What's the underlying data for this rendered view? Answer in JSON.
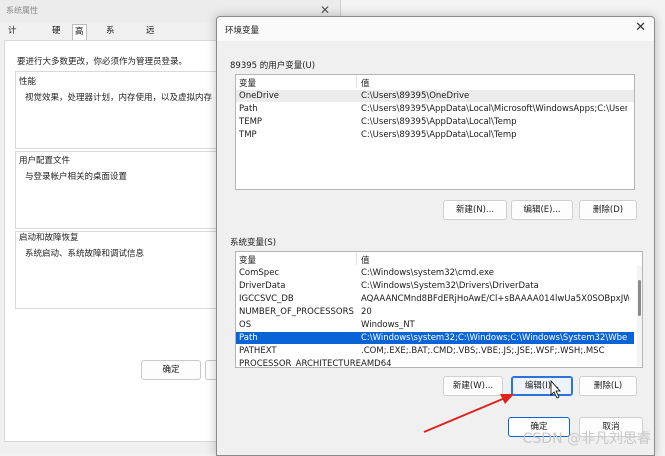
{
  "system_properties": {
    "title": "系统属性",
    "tabs": [
      "计算机名",
      "硬件",
      "高级",
      "系统保护",
      "远程"
    ],
    "admin_note": "要进行大多数更改，你必须作为管理员登录。",
    "performance": {
      "heading": "性能",
      "desc": "视觉效果，处理器计划，内存使用，以及虚拟内存"
    },
    "user_profiles": {
      "heading": "用户配置文件",
      "desc": "与登录帐户相关的桌面设置"
    },
    "startup_recovery": {
      "heading": "启动和故障恢复",
      "desc": "系统启动、系统故障和调试信息"
    },
    "ok_label": "确定"
  },
  "env_dialog": {
    "title": "环境变量",
    "user_section_label": "89395 的用户变量(U)",
    "system_section_label": "系统变量(S)",
    "columns": {
      "variable": "变量",
      "value": "值"
    },
    "user_vars": [
      {
        "name": "OneDrive",
        "value": "C:\\Users\\89395\\OneDrive"
      },
      {
        "name": "Path",
        "value": "C:\\Users\\89395\\AppData\\Local\\Microsoft\\WindowsApps;C:\\Users\\..."
      },
      {
        "name": "TEMP",
        "value": "C:\\Users\\89395\\AppData\\Local\\Temp"
      },
      {
        "name": "TMP",
        "value": "C:\\Users\\89395\\AppData\\Local\\Temp"
      }
    ],
    "system_vars": [
      {
        "name": "ComSpec",
        "value": "C:\\Windows\\system32\\cmd.exe"
      },
      {
        "name": "DriverData",
        "value": "C:\\Windows\\System32\\Drivers\\DriverData"
      },
      {
        "name": "IGCCSVC_DB",
        "value": "AQAAANCMnd8BFdERjHoAwE/Cl+sBAAAA014lwUa5X0SOBpxJW..."
      },
      {
        "name": "NUMBER_OF_PROCESSORS",
        "value": "20"
      },
      {
        "name": "OS",
        "value": "Windows_NT"
      },
      {
        "name": "Path",
        "value": "C:\\Windows\\system32;C:\\Windows;C:\\Windows\\System32\\Wbem;..."
      },
      {
        "name": "PATHEXT",
        "value": ".COM;.EXE;.BAT;.CMD;.VBS;.VBE;.JS;.JSE;.WSF;.WSH;.MSC"
      },
      {
        "name": "PROCESSOR_ARCHITECTURE",
        "value": "AMD64"
      }
    ],
    "selected_system_var": "Path",
    "user_buttons": {
      "new": "新建(N)...",
      "edit": "编辑(E)...",
      "delete": "删除(D)"
    },
    "system_buttons": {
      "new": "新建(W)...",
      "edit": "编辑(I)...",
      "delete": "删除(L)"
    },
    "ok_label": "确定",
    "cancel_label": "取消"
  },
  "watermark": "CSDN @非凡刘思睿",
  "colors": {
    "selection": "#0a64d7",
    "annotation_arrow": "#e0221c"
  }
}
